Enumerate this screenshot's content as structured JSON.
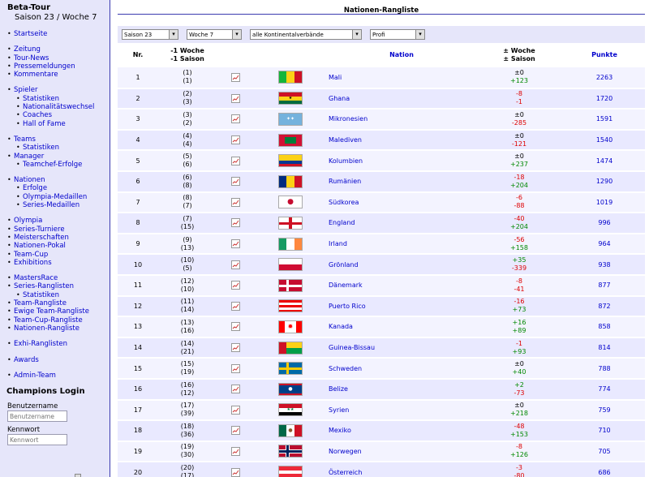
{
  "sidebar": {
    "title": "Beta-Tour",
    "season": "Saison 23 / Woche 7",
    "groups": [
      [
        {
          "label": "Startseite",
          "sub": false
        }
      ],
      [
        {
          "label": "Zeitung",
          "sub": false
        },
        {
          "label": "Tour-News",
          "sub": false
        },
        {
          "label": "Pressemeldungen",
          "sub": false
        },
        {
          "label": "Kommentare",
          "sub": false
        }
      ],
      [
        {
          "label": "Spieler",
          "sub": false
        },
        {
          "label": "Statistiken",
          "sub": true
        },
        {
          "label": "Nationalitätswechsel",
          "sub": true
        },
        {
          "label": "Coaches",
          "sub": true
        },
        {
          "label": "Hall of Fame",
          "sub": true
        }
      ],
      [
        {
          "label": "Teams",
          "sub": false
        },
        {
          "label": "Statistiken",
          "sub": true
        },
        {
          "label": "Manager",
          "sub": false
        },
        {
          "label": "Teamchef-Erfolge",
          "sub": true
        }
      ],
      [
        {
          "label": "Nationen",
          "sub": false
        },
        {
          "label": "Erfolge",
          "sub": true
        },
        {
          "label": "Olympia-Medaillen",
          "sub": true
        },
        {
          "label": "Series-Medaillen",
          "sub": true
        }
      ],
      [
        {
          "label": "Olympia",
          "sub": false
        },
        {
          "label": "Series-Turniere",
          "sub": false
        },
        {
          "label": "Meisterschaften",
          "sub": false
        },
        {
          "label": "Nationen-Pokal",
          "sub": false
        },
        {
          "label": "Team-Cup",
          "sub": false
        },
        {
          "label": "Exhibitions",
          "sub": false
        }
      ],
      [
        {
          "label": "MastersRace",
          "sub": false
        },
        {
          "label": "Series-Ranglisten",
          "sub": false
        },
        {
          "label": "Statistiken",
          "sub": true
        },
        {
          "label": "Team-Rangliste",
          "sub": false
        },
        {
          "label": "Ewige Team-Rangliste",
          "sub": false
        },
        {
          "label": "Team-Cup-Rangliste",
          "sub": false
        },
        {
          "label": "Nationen-Rangliste",
          "sub": false
        }
      ],
      [
        {
          "label": "Exhi-Ranglisten",
          "sub": false
        }
      ],
      [
        {
          "label": "Awards",
          "sub": false
        }
      ],
      [
        {
          "label": "Admin-Team",
          "sub": false
        }
      ]
    ],
    "login": {
      "title": "Champions Login",
      "user_label": "Benutzername",
      "user_placeholder": "Benutzername",
      "pass_label": "Kennwort",
      "pass_placeholder": "Kennwort"
    }
  },
  "main": {
    "title": "Nationen-Rangliste",
    "filters": [
      "Saison 23",
      "Woche 7",
      "alle Kontinentalverbände",
      "Profi"
    ],
    "headers": {
      "nr": "Nr.",
      "prev_week": "-1 Woche",
      "prev_season": "-1 Saison",
      "nation": "Nation",
      "delta_week": "± Woche",
      "delta_season": "± Saison",
      "points": "Punkte"
    },
    "rows": [
      {
        "nr": "1",
        "pw": "(1)",
        "ps": "(1)",
        "nation": "Mali",
        "dw": "±0",
        "ds": "+123",
        "pts": "2263",
        "flag": "mali"
      },
      {
        "nr": "2",
        "pw": "(2)",
        "ps": "(3)",
        "nation": "Ghana",
        "dw": "-8",
        "ds": "-1",
        "pts": "1720",
        "flag": "ghana"
      },
      {
        "nr": "3",
        "pw": "(3)",
        "ps": "(2)",
        "nation": "Mikronesien",
        "dw": "±0",
        "ds": "-285",
        "pts": "1591",
        "flag": "micronesia"
      },
      {
        "nr": "4",
        "pw": "(4)",
        "ps": "(4)",
        "nation": "Malediven",
        "dw": "±0",
        "ds": "-121",
        "pts": "1540",
        "flag": "maldives"
      },
      {
        "nr": "5",
        "pw": "(5)",
        "ps": "(6)",
        "nation": "Kolumbien",
        "dw": "±0",
        "ds": "+237",
        "pts": "1474",
        "flag": "colombia"
      },
      {
        "nr": "6",
        "pw": "(6)",
        "ps": "(8)",
        "nation": "Rumänien",
        "dw": "-18",
        "ds": "+204",
        "pts": "1290",
        "flag": "romania"
      },
      {
        "nr": "7",
        "pw": "(8)",
        "ps": "(7)",
        "nation": "Südkorea",
        "dw": "-6",
        "ds": "-88",
        "pts": "1019",
        "flag": "korea"
      },
      {
        "nr": "8",
        "pw": "(7)",
        "ps": "(15)",
        "nation": "England",
        "dw": "-40",
        "ds": "+204",
        "pts": "996",
        "flag": "england"
      },
      {
        "nr": "9",
        "pw": "(9)",
        "ps": "(13)",
        "nation": "Irland",
        "dw": "-56",
        "ds": "+158",
        "pts": "964",
        "flag": "ireland"
      },
      {
        "nr": "10",
        "pw": "(10)",
        "ps": "(5)",
        "nation": "Grönland",
        "dw": "+35",
        "ds": "-339",
        "pts": "938",
        "flag": "greenland"
      },
      {
        "nr": "11",
        "pw": "(12)",
        "ps": "(10)",
        "nation": "Dänemark",
        "dw": "-8",
        "ds": "-41",
        "pts": "877",
        "flag": "denmark"
      },
      {
        "nr": "12",
        "pw": "(11)",
        "ps": "(14)",
        "nation": "Puerto Rico",
        "dw": "-16",
        "ds": "+73",
        "pts": "872",
        "flag": "puertorico"
      },
      {
        "nr": "13",
        "pw": "(13)",
        "ps": "(16)",
        "nation": "Kanada",
        "dw": "+16",
        "ds": "+89",
        "pts": "858",
        "flag": "canada"
      },
      {
        "nr": "14",
        "pw": "(14)",
        "ps": "(21)",
        "nation": "Guinea-Bissau",
        "dw": "-1",
        "ds": "+93",
        "pts": "814",
        "flag": "guineabissau"
      },
      {
        "nr": "15",
        "pw": "(15)",
        "ps": "(19)",
        "nation": "Schweden",
        "dw": "±0",
        "ds": "+40",
        "pts": "788",
        "flag": "sweden"
      },
      {
        "nr": "16",
        "pw": "(16)",
        "ps": "(12)",
        "nation": "Belize",
        "dw": "+2",
        "ds": "-73",
        "pts": "774",
        "flag": "belize"
      },
      {
        "nr": "17",
        "pw": "(17)",
        "ps": "(39)",
        "nation": "Syrien",
        "dw": "±0",
        "ds": "+218",
        "pts": "759",
        "flag": "syria"
      },
      {
        "nr": "18",
        "pw": "(18)",
        "ps": "(36)",
        "nation": "Mexiko",
        "dw": "-48",
        "ds": "+153",
        "pts": "710",
        "flag": "mexico"
      },
      {
        "nr": "19",
        "pw": "(19)",
        "ps": "(30)",
        "nation": "Norwegen",
        "dw": "-8",
        "ds": "+126",
        "pts": "705",
        "flag": "norway"
      },
      {
        "nr": "20",
        "pw": "(20)",
        "ps": "(17)",
        "nation": "Österreich",
        "dw": "-3",
        "ds": "-80",
        "pts": "686",
        "flag": "austria"
      }
    ]
  },
  "colors": {
    "accent": "#3b3bb0",
    "sidebar_bg": "#e6e6fa",
    "link": "#0000cc",
    "positive": "#008800",
    "negative": "#dd0000"
  }
}
